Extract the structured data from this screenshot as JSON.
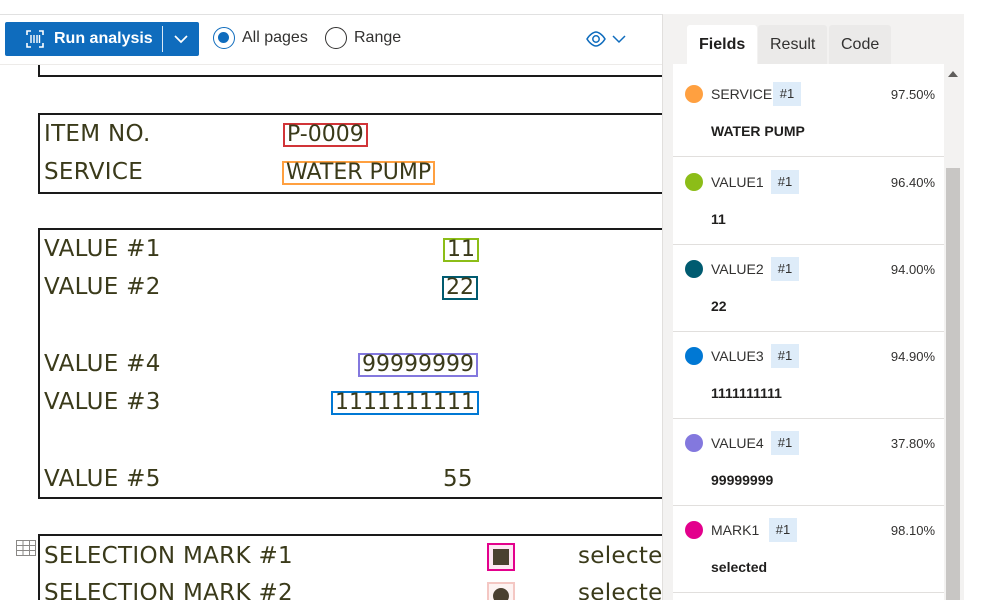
{
  "toolbar": {
    "run_label": "Run analysis",
    "radio_all": "All pages",
    "radio_range": "Range",
    "selected": "All pages"
  },
  "document": {
    "item_no_label": "ITEM NO.",
    "item_no_value": "P-0009",
    "service_label": "SERVICE",
    "service_value": "WATER PUMP",
    "value1_label": "VALUE #1",
    "value1_value": "11",
    "value2_label": "VALUE #2",
    "value2_value": "22",
    "value4_label": "VALUE #4",
    "value4_value": "99999999",
    "value3_label": "VALUE #3",
    "value3_value": "1111111111",
    "value5_label": "VALUE #5",
    "value5_value": "55",
    "mark1_label": "SELECTION MARK #1",
    "mark1_value": "selected",
    "mark2_label": "SELECTION MARK #2",
    "mark2_value": "selected"
  },
  "tabs": [
    "Fields",
    "Result",
    "Code"
  ],
  "active_tab": "Fields",
  "fields": [
    {
      "name": "SERVICE",
      "index": "#1",
      "confidence": "97.50%",
      "value": "WATER PUMP",
      "color": "#ffa040"
    },
    {
      "name": "VALUE1",
      "index": "#1",
      "confidence": "96.40%",
      "value": "11",
      "color": "#8cbd18"
    },
    {
      "name": "VALUE2",
      "index": "#1",
      "confidence": "94.00%",
      "value": "22",
      "color": "#005b70"
    },
    {
      "name": "VALUE3",
      "index": "#1",
      "confidence": "94.90%",
      "value": "1111111111",
      "color": "#0078d4"
    },
    {
      "name": "VALUE4",
      "index": "#1",
      "confidence": "37.80%",
      "value": "99999999",
      "color": "#8378de"
    },
    {
      "name": "MARK1",
      "index": "#1",
      "confidence": "98.10%",
      "value": "selected",
      "color": "#e3008c"
    }
  ],
  "colors": {
    "accent": "#0f6cbd",
    "item_no_box": "#d13438",
    "service_box": "#ffa040",
    "value1_box": "#8cbd18",
    "value2_box": "#005b70",
    "value3_box": "#0078d4",
    "value4_box": "#8378de",
    "mark1_box": "#e3008c",
    "mark2_box": "#f4c7c3"
  },
  "icons": {
    "run": "scan-icon",
    "dropdown": "chevron-down-icon",
    "view": "eye-icon",
    "table": "table-icon"
  }
}
